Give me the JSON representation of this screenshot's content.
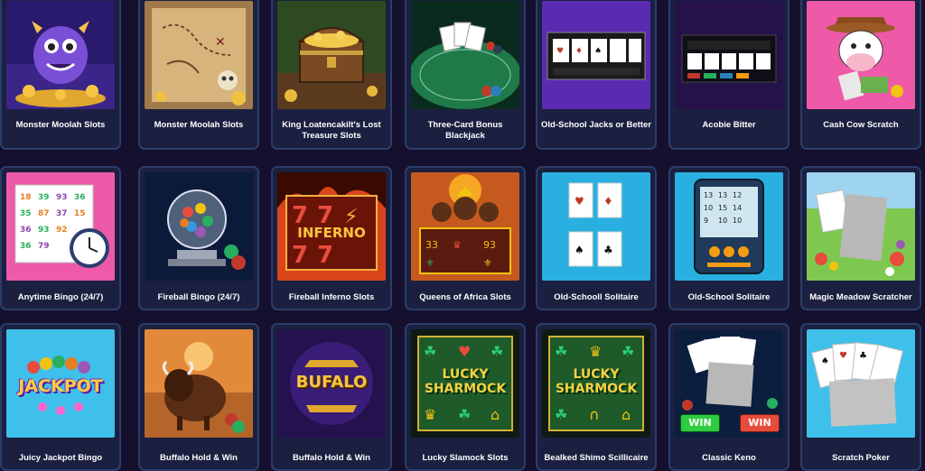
{
  "games": [
    {
      "title": "Monster Moolah Slots",
      "thumb": "purple-monster-gold-coins"
    },
    {
      "title": "Monster Moolah Slots",
      "thumb": "treasure-map-skull"
    },
    {
      "title": "King Loatencakilt's Lost Treasure Slots",
      "thumb": "treasure-chest"
    },
    {
      "title": "Three-Card Bonus Blackjack",
      "thumb": "blackjack-table"
    },
    {
      "title": "Old-School Jacks or Better",
      "thumb": "video-poker-cards"
    },
    {
      "title": "Acobie Bitter",
      "thumb": "video-poker-machine"
    },
    {
      "title": "Cash Cow Scratch",
      "thumb": "cartoon-cow"
    },
    {
      "title": "Anytime Bingo (24/7)",
      "thumb": "bingo-card-clock"
    },
    {
      "title": "Fireball Bingo (24/7)",
      "thumb": "bingo-ball-cage"
    },
    {
      "title": "Fireball Inferno Slots",
      "thumb": "inferno-77-reels",
      "text": "INFERNO"
    },
    {
      "title": "Queens of Africa Slots",
      "thumb": "queens-reels"
    },
    {
      "title": "Old-Schooll Solitaire",
      "thumb": "solitaire-cards"
    },
    {
      "title": "Old-School Solitaire",
      "thumb": "handheld-solitaire"
    },
    {
      "title": "Magic Meadow Scratcher",
      "thumb": "meadow-scratch-cards"
    },
    {
      "title": "Juicy Jackpot Bingo",
      "thumb": "jackpot-logo",
      "text": "JACKPOT"
    },
    {
      "title": "Buffalo Hold & Win",
      "thumb": "buffalo-chips"
    },
    {
      "title": "Buffalo Hold & Win",
      "thumb": "buffalo-logo",
      "text": "BUFALO"
    },
    {
      "title": "Lucky Slamock Slots",
      "thumb": "lucky-shamrock-reels",
      "text": "LUCKY SHARMOCK"
    },
    {
      "title": "Bealked Shimo Scillicaire",
      "thumb": "lucky-shamrock-reels-2",
      "text": "LUCKY SHARMOCK"
    },
    {
      "title": "Classic Keno",
      "thumb": "keno-cards-win",
      "text": "WIN"
    },
    {
      "title": "Scratch Poker",
      "thumb": "scratch-poker-cards"
    }
  ],
  "colors": {
    "page_bg": "#15102e",
    "card_bg": "#1b2040",
    "card_border": "#2b3d6b"
  }
}
